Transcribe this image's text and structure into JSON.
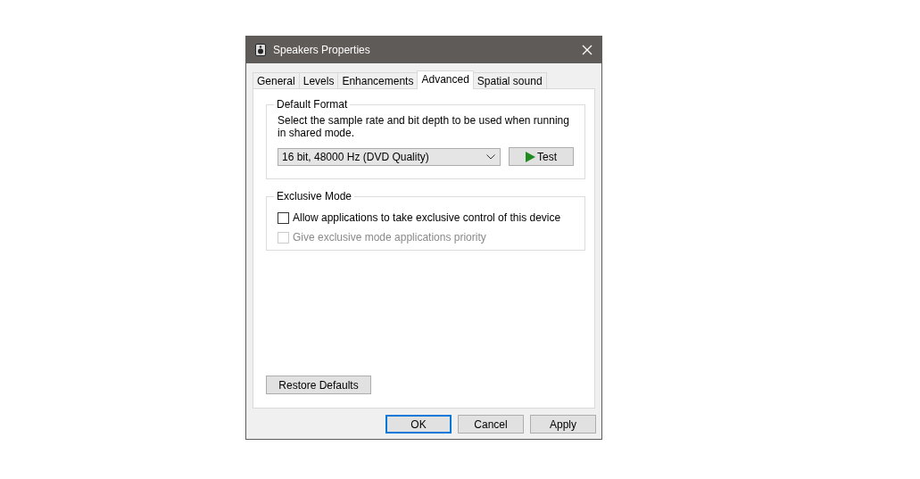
{
  "window": {
    "title": "Speakers Properties"
  },
  "tabs": [
    {
      "label": "General",
      "selected": false
    },
    {
      "label": "Levels",
      "selected": false
    },
    {
      "label": "Enhancements",
      "selected": false
    },
    {
      "label": "Advanced",
      "selected": true
    },
    {
      "label": "Spatial sound",
      "selected": false
    }
  ],
  "default_format": {
    "title": "Default Format",
    "description": "Select the sample rate and bit depth to be used when running in shared mode.",
    "format_select": {
      "value": "16 bit, 48000 Hz (DVD Quality)"
    },
    "test_button": {
      "label": "Test"
    }
  },
  "exclusive_mode": {
    "title": "Exclusive Mode",
    "options": [
      {
        "label": "Allow applications to take exclusive control of this device",
        "checked": false,
        "disabled": false
      },
      {
        "label": "Give exclusive mode applications priority",
        "checked": false,
        "disabled": true
      }
    ]
  },
  "restore_button": {
    "label": "Restore Defaults"
  },
  "buttons": [
    {
      "label": "OK",
      "default": true
    },
    {
      "label": "Cancel",
      "default": false
    },
    {
      "label": "Apply",
      "default": false
    }
  ]
}
